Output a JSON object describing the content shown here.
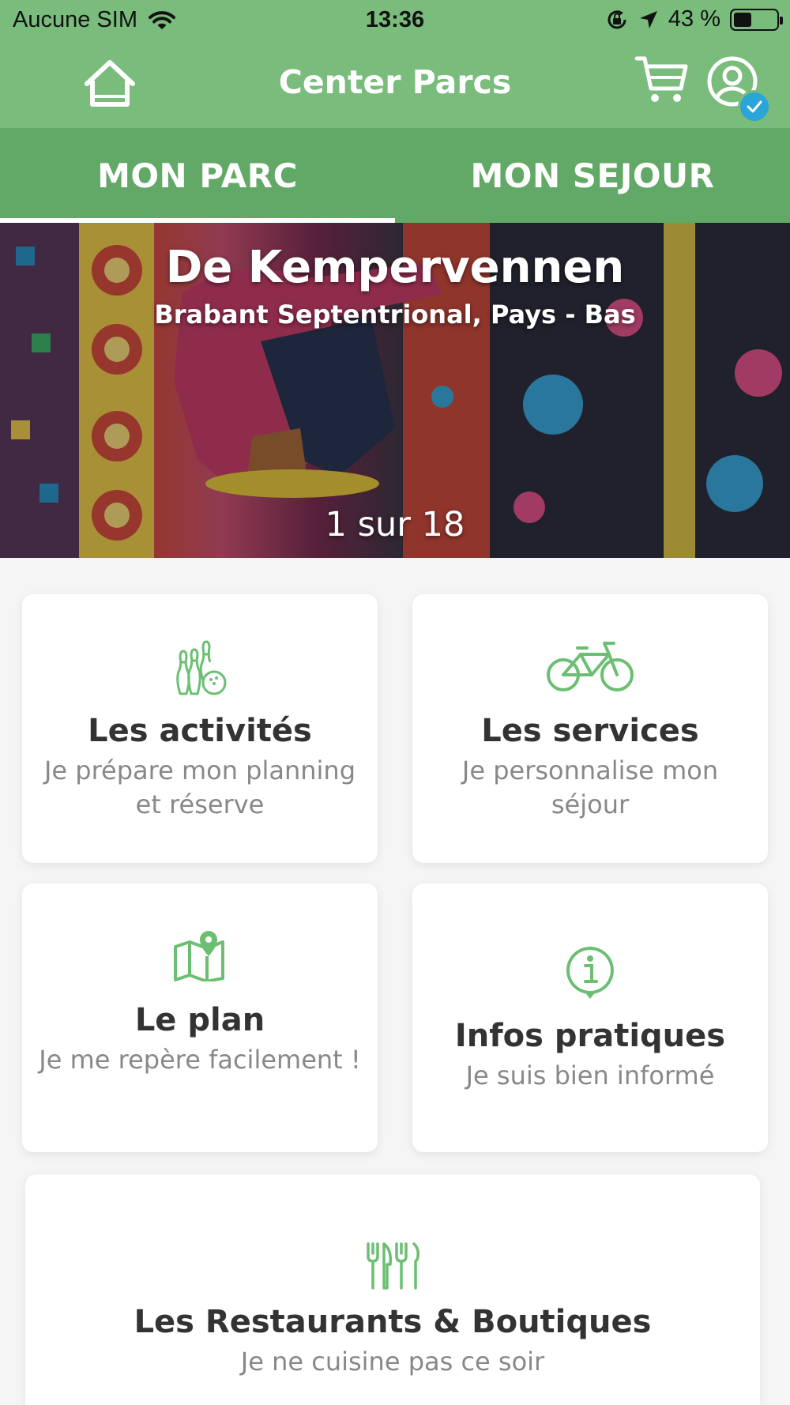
{
  "status_bar": {
    "carrier": "Aucune SIM",
    "time": "13:36",
    "battery_percent": "43 %",
    "battery_level": 0.43
  },
  "nav": {
    "title": "Center Parcs",
    "icons": [
      "home-icon",
      "cart-icon",
      "user-profile-icon",
      "check-icon"
    ]
  },
  "tabs": [
    {
      "label": "MON PARC",
      "active": true
    },
    {
      "label": "MON SEJOUR",
      "active": false
    }
  ],
  "hero": {
    "title": "De Kempervennen",
    "subtitle": "Brabant Septentrional, Pays - Bas",
    "counter": "1 sur 18"
  },
  "cards": {
    "activites": {
      "title": "Les activités",
      "subtitle": "Je prépare mon planning et réserve",
      "icon": "bowling-icon"
    },
    "services": {
      "title": "Les services",
      "subtitle": "Je personnalise mon séjour",
      "icon": "bicycle-icon"
    },
    "plan": {
      "title": "Le plan",
      "subtitle": "Je me repère facilement !",
      "icon": "map-icon"
    },
    "infos": {
      "title": "Infos pratiques",
      "subtitle": "Je suis bien informé",
      "icon": "info-icon"
    },
    "restos": {
      "title": "Les Restaurants & Boutiques",
      "subtitle": "Je ne cuisine pas ce soir",
      "icon": "cutlery-icon"
    }
  },
  "colors": {
    "header_green": "#79bc7c",
    "tab_green": "#62a866",
    "icon_green": "#6cbf72",
    "badge_blue": "#2aa5d8"
  }
}
